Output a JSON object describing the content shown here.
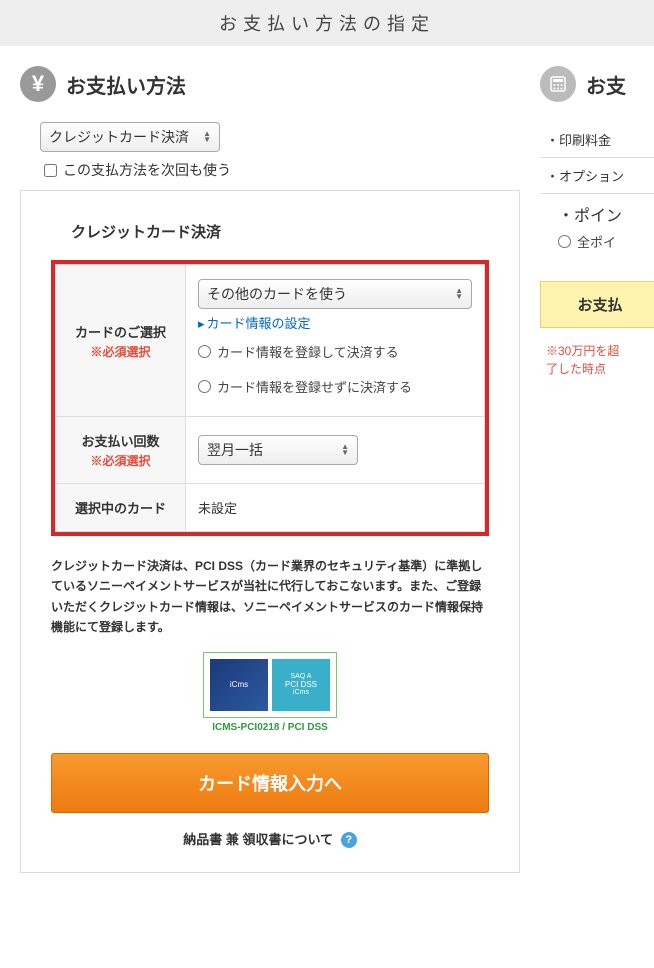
{
  "page": {
    "title": "お支払い方法の指定"
  },
  "main": {
    "header": {
      "title": "お支払い方法"
    },
    "method_select": "クレジットカード決済",
    "remember_label": "この支払方法を次回も使う",
    "panel": {
      "title": "クレジットカード決済",
      "card_select": {
        "label": "カードのご選択",
        "required": "※必須選択",
        "dropdown": "その他のカードを使う",
        "link": "カード情報の設定",
        "radio1": "カード情報を登録して決済する",
        "radio2": "カード情報を登録せずに決済する"
      },
      "installments": {
        "label": "お支払い回数",
        "required": "※必須選択",
        "dropdown": "翌月一括"
      },
      "selected_card": {
        "label": "選択中のカード",
        "value": "未設定"
      },
      "note": "クレジットカード決済は、PCI DSS（カード業界のセキュリティ基準）に準拠しているソニーペイメントサービスが当社に代行しておこないます。また、ご登録いただくクレジットカード情報は、ソニーペイメントサービスのカード情報保持機能にて登録します。",
      "cert": {
        "badge1": "iCms",
        "badge2_top": "SAQ A",
        "badge2": "PCI DSS",
        "badge2_sub": "iCms",
        "label": "ICMS-PCI0218 / PCI DSS"
      },
      "cta": "カード情報入力へ",
      "receipt": "納品書 兼 領収書について"
    }
  },
  "sidebar": {
    "header": {
      "title": "お支"
    },
    "items": [
      "印刷料金",
      "オプション"
    ],
    "sub_item": "ポイン",
    "radio": "全ポイ",
    "cta": "お支払",
    "note": "※30万円を超\n了した時点"
  }
}
